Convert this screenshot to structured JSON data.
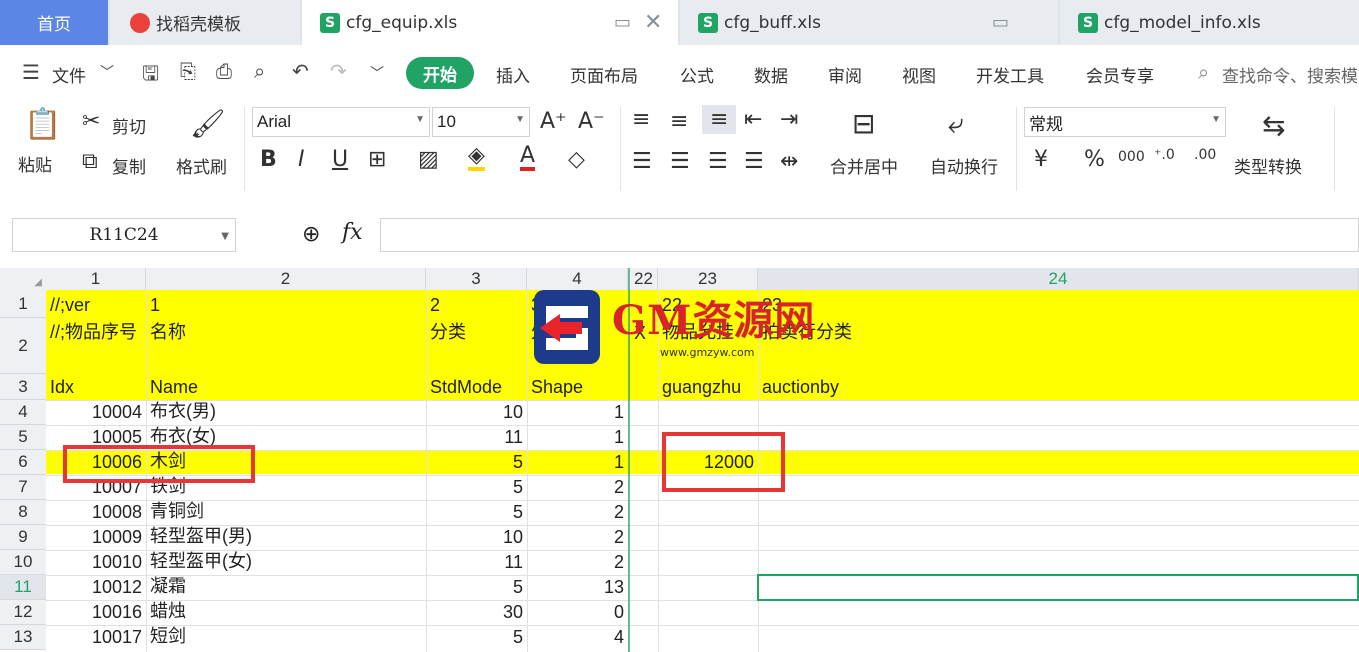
{
  "tabs": {
    "home": "首页",
    "t1": "找稻壳模板",
    "t2": "cfg_equip.xls",
    "t3": "cfg_buff.xls",
    "t4": "cfg_model_info.xls",
    "sheet_icon": "S"
  },
  "menu": {
    "file": "文件",
    "start": "开始",
    "items": [
      "插入",
      "页面布局",
      "公式",
      "数据",
      "审阅",
      "视图",
      "开发工具",
      "会员专享"
    ],
    "search": "查找命令、搜索模"
  },
  "ribbon": {
    "paste": "粘贴",
    "cut": "剪切",
    "copy": "复制",
    "format_painter": "格式刷",
    "font": "Arial",
    "font_size": "10",
    "merge_center": "合并居中",
    "wrap": "自动换行",
    "number_format": "常规",
    "percent": "%",
    "type_convert": "类型转换"
  },
  "formula_bar": {
    "name_box": "R11C24",
    "fx": "fx",
    "content": ""
  },
  "columns": [
    "1",
    "2",
    "3",
    "4",
    "22",
    "23",
    "24"
  ],
  "rows": [
    {
      "n": "1",
      "c1": "//;ver",
      "c2": "1",
      "c3": "2",
      "c4": "3",
      "c22": "",
      "c23": "22",
      "c24": "23"
    },
    {
      "n": "2",
      "c1": "//;物品序号",
      "c2": "名称",
      "c3": "分类",
      "c4": "外观",
      "c22": "X",
      "c23": "物品允挂",
      "c24": "拍卖行分类"
    },
    {
      "n": "3",
      "c1": "Idx",
      "c2": "Name",
      "c3": "StdMode",
      "c4": "Shape",
      "c22": "",
      "c23": "guangzhu",
      "c24": "auctionby"
    },
    {
      "n": "4",
      "c1": "10004",
      "c2": "布衣(男)",
      "c3": "10",
      "c4": "1",
      "c23": ""
    },
    {
      "n": "5",
      "c1": "10005",
      "c2": "布衣(女)",
      "c3": "11",
      "c4": "1",
      "c23": ""
    },
    {
      "n": "6",
      "c1": "10006",
      "c2": "木剑",
      "c3": "5",
      "c4": "1",
      "c23": "12000"
    },
    {
      "n": "7",
      "c1": "10007",
      "c2": "铁剑",
      "c3": "5",
      "c4": "2",
      "c23": ""
    },
    {
      "n": "8",
      "c1": "10008",
      "c2": "青铜剑",
      "c3": "5",
      "c4": "2",
      "c23": ""
    },
    {
      "n": "9",
      "c1": "10009",
      "c2": "轻型盔甲(男)",
      "c3": "10",
      "c4": "2",
      "c23": ""
    },
    {
      "n": "10",
      "c1": "10010",
      "c2": "轻型盔甲(女)",
      "c3": "11",
      "c4": "2",
      "c23": ""
    },
    {
      "n": "11",
      "c1": "10012",
      "c2": "凝霜",
      "c3": "5",
      "c4": "13",
      "c23": ""
    },
    {
      "n": "12",
      "c1": "10016",
      "c2": "蜡烛",
      "c3": "30",
      "c4": "0",
      "c23": ""
    },
    {
      "n": "13",
      "c1": "10017",
      "c2": "短剑",
      "c3": "5",
      "c4": "4",
      "c23": ""
    }
  ],
  "watermark": {
    "text": "GM资源网",
    "url": "www.gmzyw.com"
  },
  "colors": {
    "accent": "#21a366",
    "highlight": "#ffff00",
    "annotation": "#e83535",
    "home_tab": "#5b86e5"
  }
}
